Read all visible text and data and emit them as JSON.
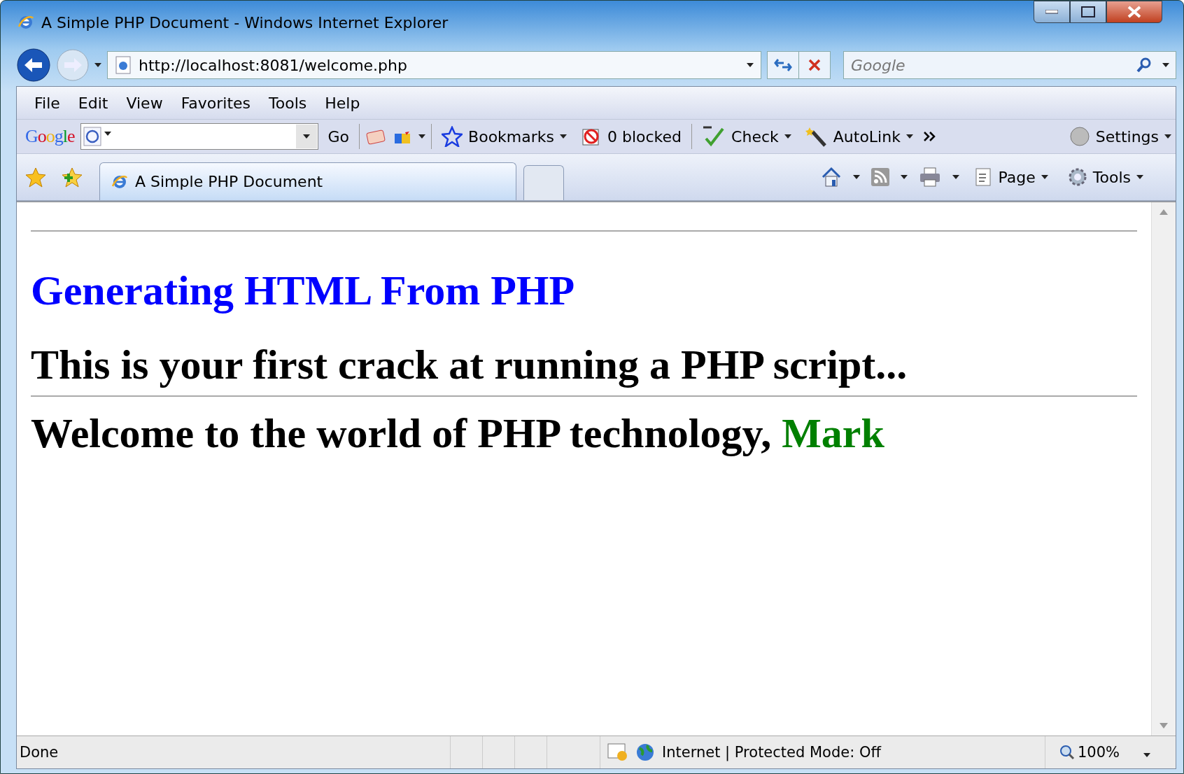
{
  "window": {
    "title": "A Simple PHP Document - Windows Internet Explorer"
  },
  "address_bar": {
    "url": "http://localhost:8081/welcome.php"
  },
  "search": {
    "placeholder": "Google"
  },
  "menu": [
    "File",
    "Edit",
    "View",
    "Favorites",
    "Tools",
    "Help"
  ],
  "google_toolbar": {
    "logo": "Google",
    "go": "Go",
    "items": [
      {
        "label": "Bookmarks",
        "kind": "star"
      },
      {
        "label": "0 blocked",
        "kind": "block"
      },
      {
        "label": "Check",
        "kind": "check"
      },
      {
        "label": "AutoLink",
        "kind": "wand"
      }
    ],
    "settings": "Settings"
  },
  "tabs": [
    {
      "label": "A Simple PHP Document",
      "selected": true
    }
  ],
  "command_bar": [
    "Page",
    "Tools"
  ],
  "page": {
    "heading": "Generating HTML From PHP",
    "line": "This is your first crack at running a PHP script...",
    "welcome": "Welcome to the world of PHP technology, ",
    "name": "Mark"
  },
  "status_bar": {
    "status": "Done",
    "zone": "Internet | Protected Mode: Off",
    "zoom": "100%"
  }
}
